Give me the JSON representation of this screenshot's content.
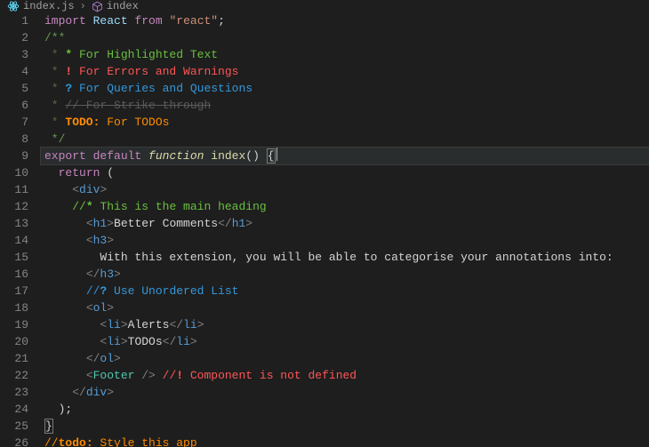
{
  "colors": {
    "bg": "#1e1e1e",
    "active_line_bg": "#2a2d2e"
  },
  "breadcrumbs": {
    "file_icon": "react-icon",
    "file": "index.js",
    "sep": "›",
    "symbol_icon": "cube-icon",
    "symbol": "index"
  },
  "active_line": 9,
  "lines": [
    {
      "n": 1,
      "tokens": [
        {
          "t": "import",
          "c": "c-keyword"
        },
        {
          "t": " ",
          "c": "c-punc"
        },
        {
          "t": "React",
          "c": "c-var"
        },
        {
          "t": " ",
          "c": "c-punc"
        },
        {
          "t": "from",
          "c": "c-keyword"
        },
        {
          "t": " ",
          "c": "c-punc"
        },
        {
          "t": "\"react\"",
          "c": "c-string"
        },
        {
          "t": ";",
          "c": "c-punc"
        }
      ]
    },
    {
      "n": 2,
      "tokens": [
        {
          "t": "/**",
          "c": "c-comment"
        }
      ]
    },
    {
      "n": 3,
      "tokens": [
        {
          "t": " * ",
          "c": "c-commentdim"
        },
        {
          "t": "*",
          "c": "c-star-g"
        },
        {
          "t": " For Highlighted Text",
          "c": "c-star-txt"
        }
      ]
    },
    {
      "n": 4,
      "tokens": [
        {
          "t": " * ",
          "c": "c-commentdim"
        },
        {
          "t": "!",
          "c": "c-bang"
        },
        {
          "t": " For Errors and Warnings",
          "c": "c-bang-txt"
        }
      ]
    },
    {
      "n": 5,
      "tokens": [
        {
          "t": " * ",
          "c": "c-commentdim"
        },
        {
          "t": "?",
          "c": "c-q"
        },
        {
          "t": " For Queries and Questions",
          "c": "c-q-txt"
        }
      ]
    },
    {
      "n": 6,
      "tokens": [
        {
          "t": " * ",
          "c": "c-commentdim"
        },
        {
          "t": "// For Strike-through",
          "c": "c-strike"
        }
      ]
    },
    {
      "n": 7,
      "tokens": [
        {
          "t": " * ",
          "c": "c-commentdim"
        },
        {
          "t": "TODO:",
          "c": "c-todo"
        },
        {
          "t": " For TODOs",
          "c": "c-todo-txt"
        }
      ]
    },
    {
      "n": 8,
      "tokens": [
        {
          "t": " */",
          "c": "c-comment"
        }
      ]
    },
    {
      "n": 9,
      "tokens": [
        {
          "t": "export",
          "c": "c-keyword"
        },
        {
          "t": " ",
          "c": "c-punc"
        },
        {
          "t": "default",
          "c": "c-keyword"
        },
        {
          "t": " ",
          "c": "c-punc"
        },
        {
          "t": "function",
          "c": "c-fn-it"
        },
        {
          "t": " ",
          "c": "c-punc"
        },
        {
          "t": "index",
          "c": "c-fn"
        },
        {
          "t": "()",
          "c": "c-punc"
        },
        {
          "t": " ",
          "c": "c-punc"
        },
        {
          "t": "{",
          "c": "c-punc bracket-box"
        }
      ]
    },
    {
      "n": 10,
      "tokens": [
        {
          "t": "  ",
          "c": "c-punc"
        },
        {
          "t": "return",
          "c": "c-keyword"
        },
        {
          "t": " (",
          "c": "c-punc"
        }
      ]
    },
    {
      "n": 11,
      "tokens": [
        {
          "t": "    ",
          "c": "c-punc"
        },
        {
          "t": "<",
          "c": "c-tag"
        },
        {
          "t": "div",
          "c": "c-tagname"
        },
        {
          "t": ">",
          "c": "c-tag"
        }
      ]
    },
    {
      "n": 12,
      "tokens": [
        {
          "t": "    ",
          "c": "c-punc"
        },
        {
          "t": "//",
          "c": "c-star-txt"
        },
        {
          "t": "*",
          "c": "c-star-g"
        },
        {
          "t": " This is the main heading",
          "c": "c-star-txt"
        }
      ]
    },
    {
      "n": 13,
      "tokens": [
        {
          "t": "      ",
          "c": "c-punc"
        },
        {
          "t": "<",
          "c": "c-tag"
        },
        {
          "t": "h1",
          "c": "c-tagname"
        },
        {
          "t": ">",
          "c": "c-tag"
        },
        {
          "t": "Better Comments",
          "c": "c-text"
        },
        {
          "t": "</",
          "c": "c-tag"
        },
        {
          "t": "h1",
          "c": "c-tagname"
        },
        {
          "t": ">",
          "c": "c-tag"
        }
      ]
    },
    {
      "n": 14,
      "tokens": [
        {
          "t": "      ",
          "c": "c-punc"
        },
        {
          "t": "<",
          "c": "c-tag"
        },
        {
          "t": "h3",
          "c": "c-tagname"
        },
        {
          "t": ">",
          "c": "c-tag"
        }
      ]
    },
    {
      "n": 15,
      "tokens": [
        {
          "t": "        With this extension, you will be able to categorise your annotations into:",
          "c": "c-text"
        }
      ]
    },
    {
      "n": 16,
      "tokens": [
        {
          "t": "      ",
          "c": "c-punc"
        },
        {
          "t": "</",
          "c": "c-tag"
        },
        {
          "t": "h3",
          "c": "c-tagname"
        },
        {
          "t": ">",
          "c": "c-tag"
        }
      ]
    },
    {
      "n": 17,
      "tokens": [
        {
          "t": "      ",
          "c": "c-punc"
        },
        {
          "t": "//",
          "c": "c-q-txt"
        },
        {
          "t": "?",
          "c": "c-q"
        },
        {
          "t": " Use Unordered List",
          "c": "c-q-txt"
        }
      ]
    },
    {
      "n": 18,
      "tokens": [
        {
          "t": "      ",
          "c": "c-punc"
        },
        {
          "t": "<",
          "c": "c-tag"
        },
        {
          "t": "ol",
          "c": "c-tagname"
        },
        {
          "t": ">",
          "c": "c-tag"
        }
      ]
    },
    {
      "n": 19,
      "tokens": [
        {
          "t": "        ",
          "c": "c-punc"
        },
        {
          "t": "<",
          "c": "c-tag"
        },
        {
          "t": "li",
          "c": "c-tagname"
        },
        {
          "t": ">",
          "c": "c-tag"
        },
        {
          "t": "Alerts",
          "c": "c-text"
        },
        {
          "t": "</",
          "c": "c-tag"
        },
        {
          "t": "li",
          "c": "c-tagname"
        },
        {
          "t": ">",
          "c": "c-tag"
        }
      ]
    },
    {
      "n": 20,
      "tokens": [
        {
          "t": "        ",
          "c": "c-punc"
        },
        {
          "t": "<",
          "c": "c-tag"
        },
        {
          "t": "li",
          "c": "c-tagname"
        },
        {
          "t": ">",
          "c": "c-tag"
        },
        {
          "t": "TODOs",
          "c": "c-text"
        },
        {
          "t": "</",
          "c": "c-tag"
        },
        {
          "t": "li",
          "c": "c-tagname"
        },
        {
          "t": ">",
          "c": "c-tag"
        }
      ]
    },
    {
      "n": 21,
      "tokens": [
        {
          "t": "      ",
          "c": "c-punc"
        },
        {
          "t": "</",
          "c": "c-tag"
        },
        {
          "t": "ol",
          "c": "c-tagname"
        },
        {
          "t": ">",
          "c": "c-tag"
        }
      ]
    },
    {
      "n": 22,
      "tokens": [
        {
          "t": "      ",
          "c": "c-punc"
        },
        {
          "t": "<",
          "c": "c-tag"
        },
        {
          "t": "Footer",
          "c": "c-component"
        },
        {
          "t": " />",
          "c": "c-tag"
        },
        {
          "t": " ",
          "c": "c-punc"
        },
        {
          "t": "//",
          "c": "c-bang-txt"
        },
        {
          "t": "!",
          "c": "c-bang"
        },
        {
          "t": " Component is not defined",
          "c": "c-bang-txt"
        }
      ]
    },
    {
      "n": 23,
      "tokens": [
        {
          "t": "    ",
          "c": "c-punc"
        },
        {
          "t": "</",
          "c": "c-tag"
        },
        {
          "t": "div",
          "c": "c-tagname"
        },
        {
          "t": ">",
          "c": "c-tag"
        }
      ]
    },
    {
      "n": 24,
      "tokens": [
        {
          "t": "  );",
          "c": "c-punc"
        }
      ]
    },
    {
      "n": 25,
      "tokens": [
        {
          "t": "}",
          "c": "c-punc bracket-box"
        }
      ]
    },
    {
      "n": 26,
      "tokens": [
        {
          "t": "//",
          "c": "c-todo-txt"
        },
        {
          "t": "todo:",
          "c": "c-todo"
        },
        {
          "t": " Style this app",
          "c": "c-todo-txt"
        }
      ]
    }
  ]
}
